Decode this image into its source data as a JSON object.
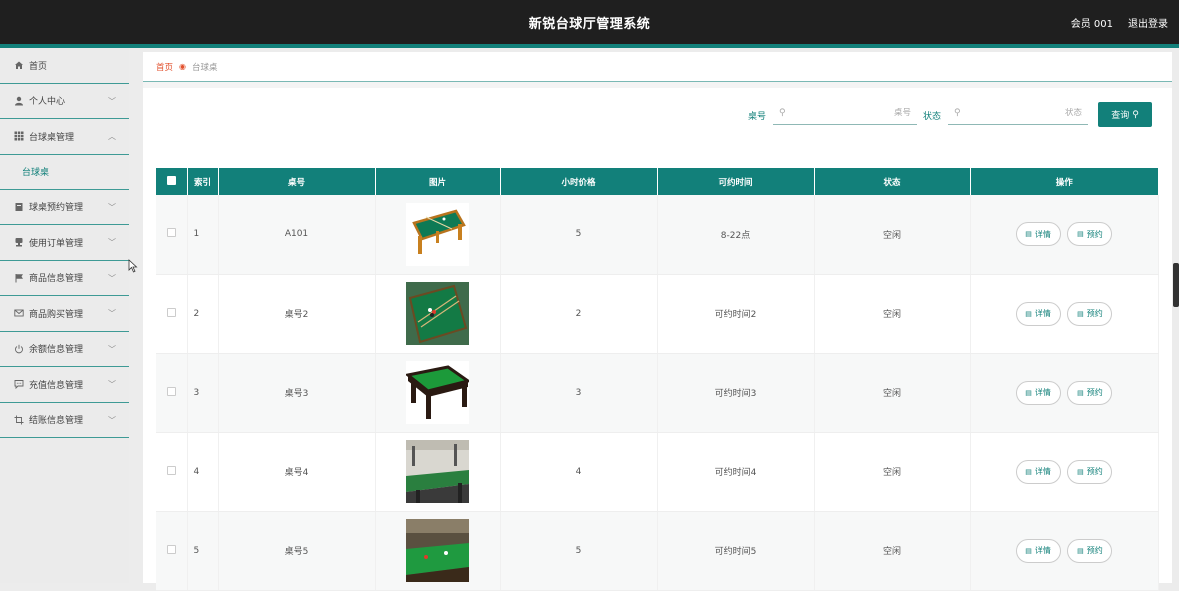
{
  "header": {
    "title": "新锐台球厅管理系统",
    "user": "会员 001",
    "logout": "退出登录"
  },
  "sidebar": {
    "items": [
      {
        "label": "首页",
        "icon": "home-icon",
        "chevron": ""
      },
      {
        "label": "个人中心",
        "icon": "user-icon",
        "chevron": "﹀"
      },
      {
        "label": "台球桌管理",
        "icon": "grid-icon",
        "chevron": "︿"
      },
      {
        "label": "台球桌",
        "sub": true
      },
      {
        "label": "球桌预约管理",
        "icon": "book-icon",
        "chevron": "﹀"
      },
      {
        "label": "使用订单管理",
        "icon": "stamp-icon",
        "chevron": "﹀"
      },
      {
        "label": "商品信息管理",
        "icon": "flag-icon",
        "chevron": "﹀"
      },
      {
        "label": "商品购买管理",
        "icon": "mail-icon",
        "chevron": "﹀"
      },
      {
        "label": "余额信息管理",
        "icon": "power-icon",
        "chevron": "﹀"
      },
      {
        "label": "充值信息管理",
        "icon": "chat-icon",
        "chevron": "﹀"
      },
      {
        "label": "结账信息管理",
        "icon": "crop-icon",
        "chevron": "﹀"
      }
    ]
  },
  "breadcrumb": {
    "home": "首页",
    "current": "台球桌"
  },
  "search": {
    "table_label": "桌号",
    "table_placeholder": "桌号",
    "status_label": "状态",
    "status_placeholder": "状态",
    "button": "查询"
  },
  "table": {
    "headers": [
      "索引",
      "桌号",
      "图片",
      "小时价格",
      "可约时间",
      "状态",
      "操作"
    ],
    "rows": [
      {
        "index": "1",
        "number": "A101",
        "price": "5",
        "time": "8-22点",
        "status": "空闲"
      },
      {
        "index": "2",
        "number": "桌号2",
        "price": "2",
        "time": "可约时间2",
        "status": "空闲"
      },
      {
        "index": "3",
        "number": "桌号3",
        "price": "3",
        "time": "可约时间3",
        "status": "空闲"
      },
      {
        "index": "4",
        "number": "桌号4",
        "price": "4",
        "time": "可约时间4",
        "status": "空闲"
      },
      {
        "index": "5",
        "number": "桌号5",
        "price": "5",
        "time": "可约时间5",
        "status": "空闲"
      }
    ],
    "actions": {
      "detail": "详情",
      "reserve": "预约"
    }
  },
  "colors": {
    "accent": "#12807a",
    "header_bg": "#1f1f1f",
    "crumb_home": "#e2502d"
  }
}
